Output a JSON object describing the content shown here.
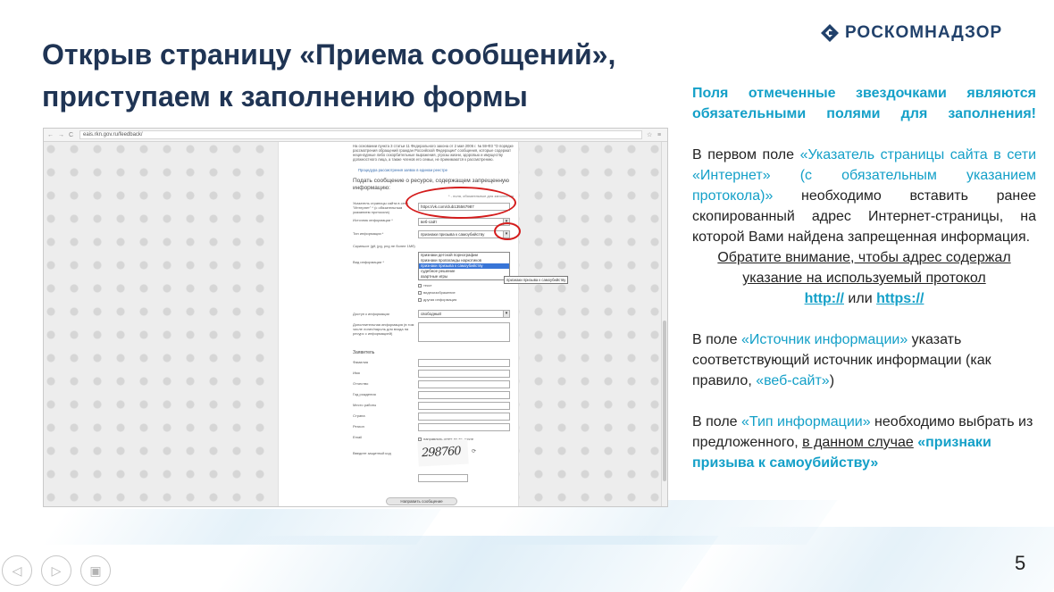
{
  "slide": {
    "title": "Открыв страницу «Приема сообщений», приступаем к заполнению формы",
    "page_number": "5"
  },
  "logo": {
    "text": "РОСКОМНАДЗОР",
    "color": "#21416b"
  },
  "browser": {
    "url": "eais.rkn.gov.ru/feedback/",
    "intro_text": "На основании пункта 3 статьи 11 Федерального закона от 2 мая 2006 г. № 59-ФЗ \"О порядке рассмотрения обращений граждан Российской Федерации\" сообщения, которые содержат нецензурные либо оскорбительные выражения, угрозы жизни, здоровью и имуществу должностного лица, а также членов его семьи, не принимаются к рассмотрению.",
    "search_link": "Процедура рассмотрения заявок в едином реестре",
    "form_heading": "Подать сообщение о ресурсе, содержащем запрещенную информацию:",
    "required_note": "* - поля, обязательные для заполнения",
    "fields": {
      "url_label": "Указатель страницы сайта в сети \"Интернет\" * (с обязательным указанием протокола)",
      "url_value": "https://vk.com/club135567987",
      "source_label": "Источник информации *",
      "source_value": "веб-сайт",
      "type_label": "Тип информации *",
      "type_value": "признаки призыва к самоубийству",
      "screenshot_label": "Скриншот (gif, jpg, png не более 1Мб)",
      "media_label": "Вид информации *",
      "access_label": "Доступ к информации",
      "access_value": "свободный",
      "extra_label": "Дополнительная информация (в том числе логин/пароль для входа на ресурс с информацией)"
    },
    "type_options": [
      "признаки детской порнографии",
      "признаки пропаганды наркотиков",
      "признаки призыва к самоубийству",
      "судебное решение",
      "азартные игры"
    ],
    "tooltip": "признаки призыва к самоубийству",
    "media_options": [
      "текст",
      "видеоизображение",
      "другая информация"
    ],
    "applicant_heading": "Заявитель",
    "applicant_fields": [
      "Фамилия",
      "Имя",
      "Отчество",
      "Год рождения",
      "Место работы",
      "Страна",
      "Регион",
      "Email"
    ],
    "reply_checkbox": "направлять ответ по эл. почте",
    "captcha_label": "Введите защитный код",
    "captcha_text": "298760",
    "submit_label": "Направить сообщение"
  },
  "notes": {
    "required_fields": "Поля отмеченные звездочками являются обязательными полями для заполнения!",
    "p1_pre": "В первом поле ",
    "p1_field": "«Указатель страницы сайта в сети «Интернет» (с обязательным указанием протокола)»",
    "p1_post": " необходимо вставить ранее скопированный адрес Интернет-страницы, на которой Вами найдена запрещенная информация.",
    "p1_attention": "Обратите внимание, чтобы адрес содержал указание на используемый протокол",
    "proto_http": "http://",
    "proto_or": " или ",
    "proto_https": "https://",
    "p2_pre": "В поле ",
    "p2_field": "«Источник информации»",
    "p2_mid": " указать соответствующий источник информации (как правило, ",
    "p2_value": "«веб-сайт»",
    "p2_end": ")",
    "p3_pre": "В поле ",
    "p3_field": "«Тип информации»",
    "p3_mid": " необходимо выбрать из предложенного, ",
    "p3_case": "в данном случае",
    "p3_value": " «признаки призыва к самоубийству»"
  },
  "colors": {
    "title": "#1f3454",
    "accent": "#14a0c8",
    "highlight": "#d41c1c"
  }
}
